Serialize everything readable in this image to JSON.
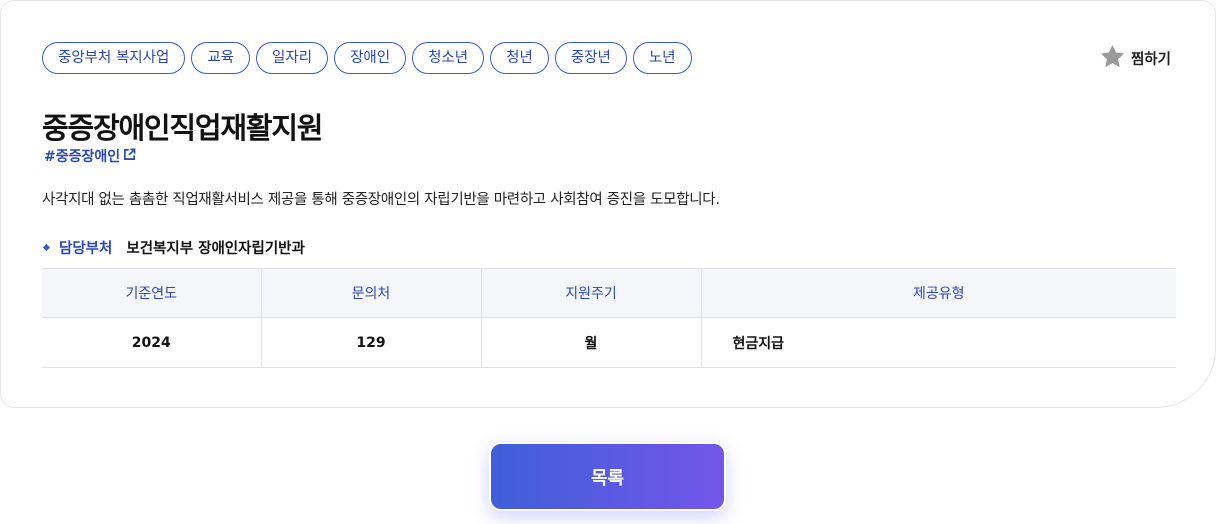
{
  "tags": [
    "중앙부처 복지사업",
    "교육",
    "일자리",
    "장애인",
    "청소년",
    "청년",
    "중장년",
    "노년"
  ],
  "favorite": {
    "label": "찜하기",
    "icon": "star-icon"
  },
  "program": {
    "title": "중증장애인직업재활지원",
    "hashtag": "#중증장애인",
    "description": "사각지대 없는 촘촘한 직업재활서비스 제공을 통해 중증장애인의 자립기반을 마련하고 사회참여 증진을 도모합니다."
  },
  "department": {
    "label": "담당부처",
    "value": "보건복지부 장애인자립기반과"
  },
  "table": {
    "headers": [
      "기준연도",
      "문의처",
      "지원주기",
      "제공유형"
    ],
    "row": [
      "2024",
      "129",
      "월",
      "현금지급"
    ]
  },
  "list_button": "목록",
  "colors": {
    "accent": "#2c48b5",
    "button_start": "#3f5fd8",
    "button_end": "#7356ea"
  }
}
